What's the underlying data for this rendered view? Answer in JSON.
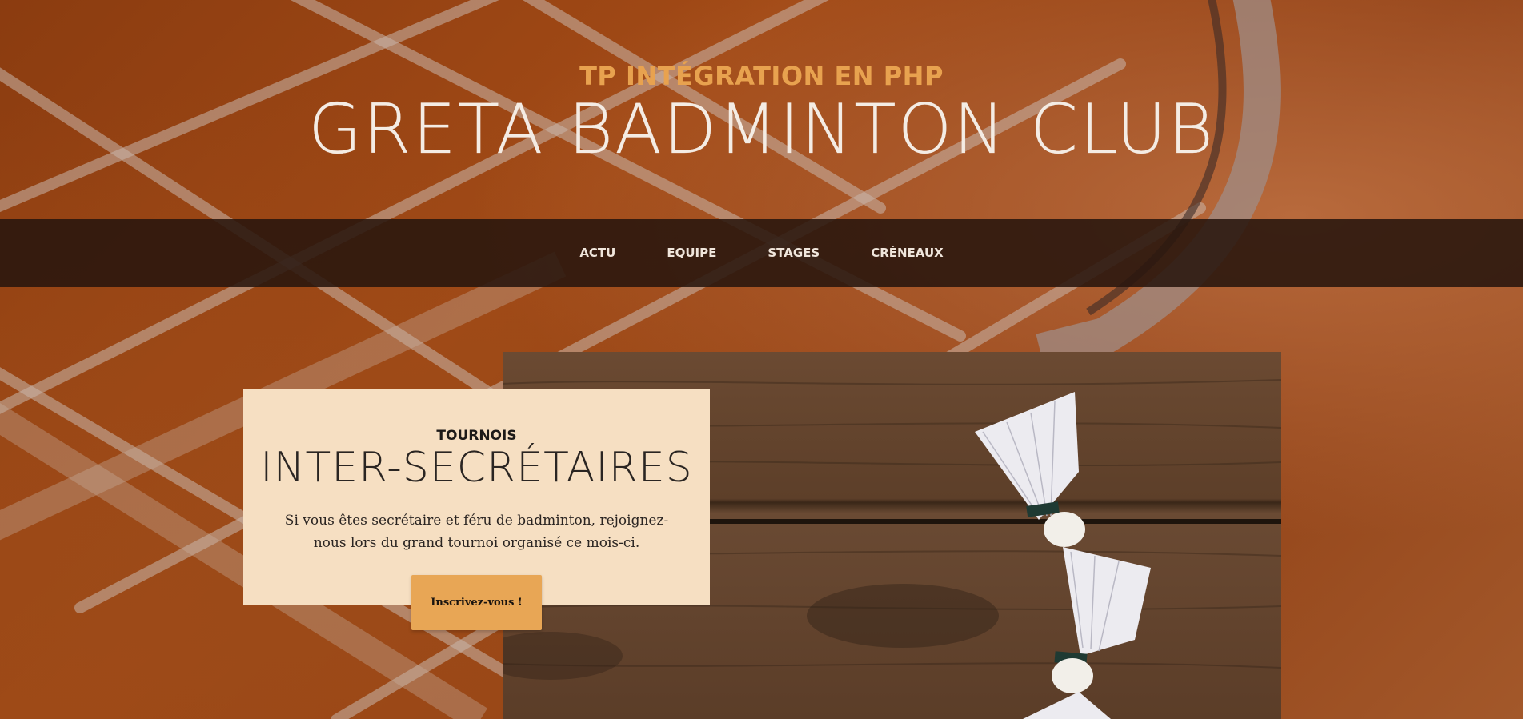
{
  "header": {
    "subtitle": "TP INTÉGRATION EN PHP",
    "title": "GRETA BADMINTON CLUB"
  },
  "nav": {
    "items": [
      {
        "label": "ACTU"
      },
      {
        "label": "EQUIPE"
      },
      {
        "label": "STAGES"
      },
      {
        "label": "CRÉNEAUX"
      }
    ]
  },
  "promo": {
    "kicker": "TOURNOIS",
    "title": "INTER-SECRÉTAIRES",
    "text": "Si vous êtes secrétaire et féru de badminton, rejoignez-nous lors du grand tournoi organisé ce mois-ci.",
    "button_label": "Inscrivez-vous !"
  },
  "colors": {
    "accent": "#e8a655",
    "subtitle": "#e8a24f",
    "nav_bg": "#28160e",
    "card_bg": "#f6dfc2"
  }
}
